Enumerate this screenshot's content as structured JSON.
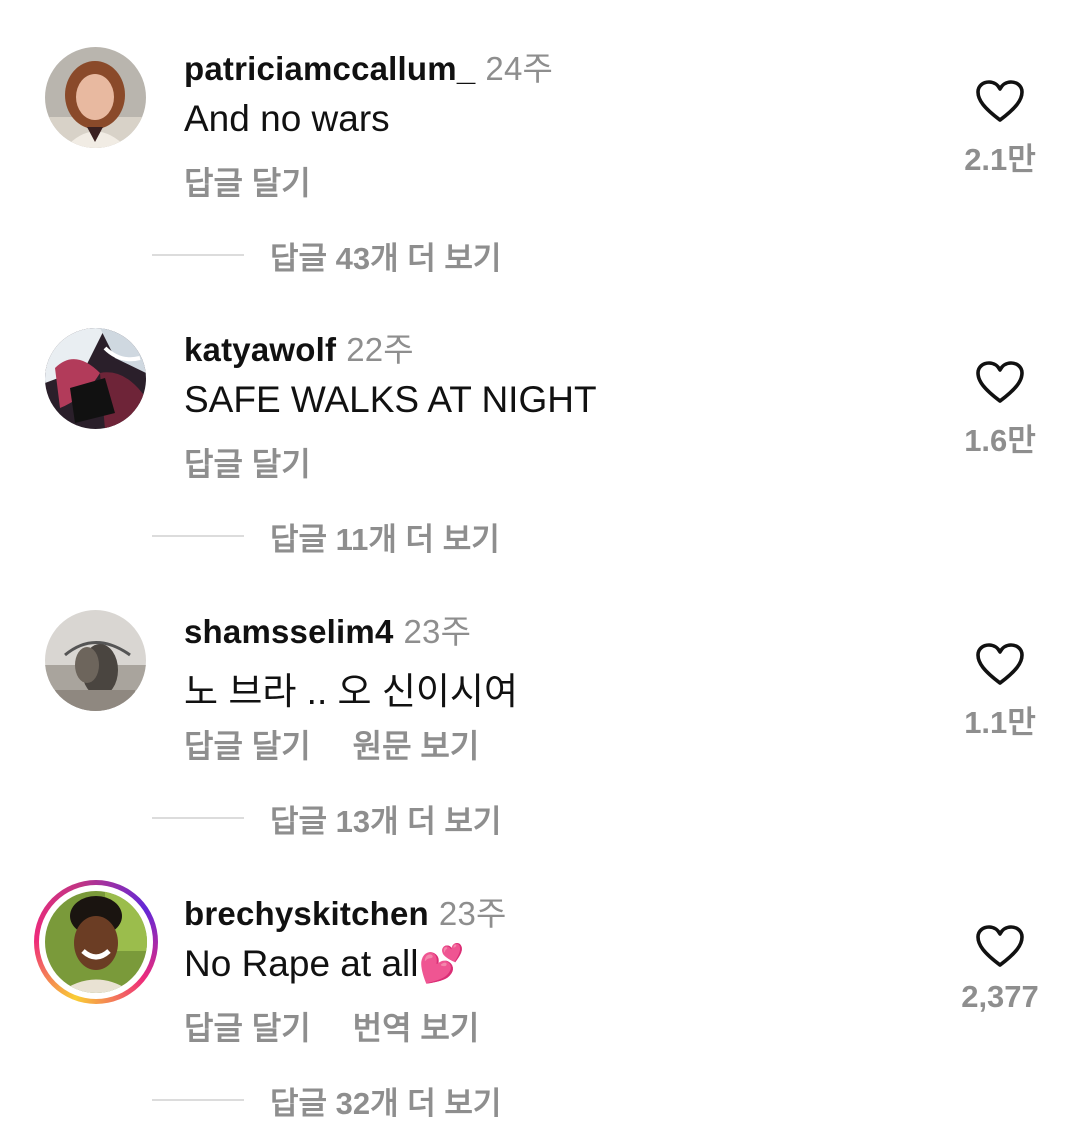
{
  "comments": [
    {
      "username": "patriciamccallum_",
      "time": "24주",
      "text": "And no wars",
      "actions": [
        "답글 달기"
      ],
      "likes": "2.1만",
      "more_replies": "답글 43개 더 보기"
    },
    {
      "username": "katyawolf",
      "time": "22주",
      "text": "SAFE WALKS AT NIGHT",
      "actions": [
        "답글 달기"
      ],
      "likes": "1.6만",
      "more_replies": "답글 11개 더 보기"
    },
    {
      "username": "shamsselim4",
      "time": "23주",
      "text": "노 브라 .. 오 신이시여",
      "actions": [
        "답글 달기",
        "원문 보기"
      ],
      "likes": "1.1만",
      "more_replies": "답글 13개 더 보기"
    },
    {
      "username": "brechyskitchen",
      "time": "23주",
      "text": "No Rape at all💕",
      "actions": [
        "답글 달기",
        "번역 보기"
      ],
      "likes": "2,377",
      "more_replies": "답글 32개 더 보기"
    }
  ],
  "icons": {
    "like": "heart-outline-icon"
  },
  "colors": {
    "text": "#111111",
    "secondary": "#8e8e8e",
    "divider": "#dcdcdc"
  }
}
